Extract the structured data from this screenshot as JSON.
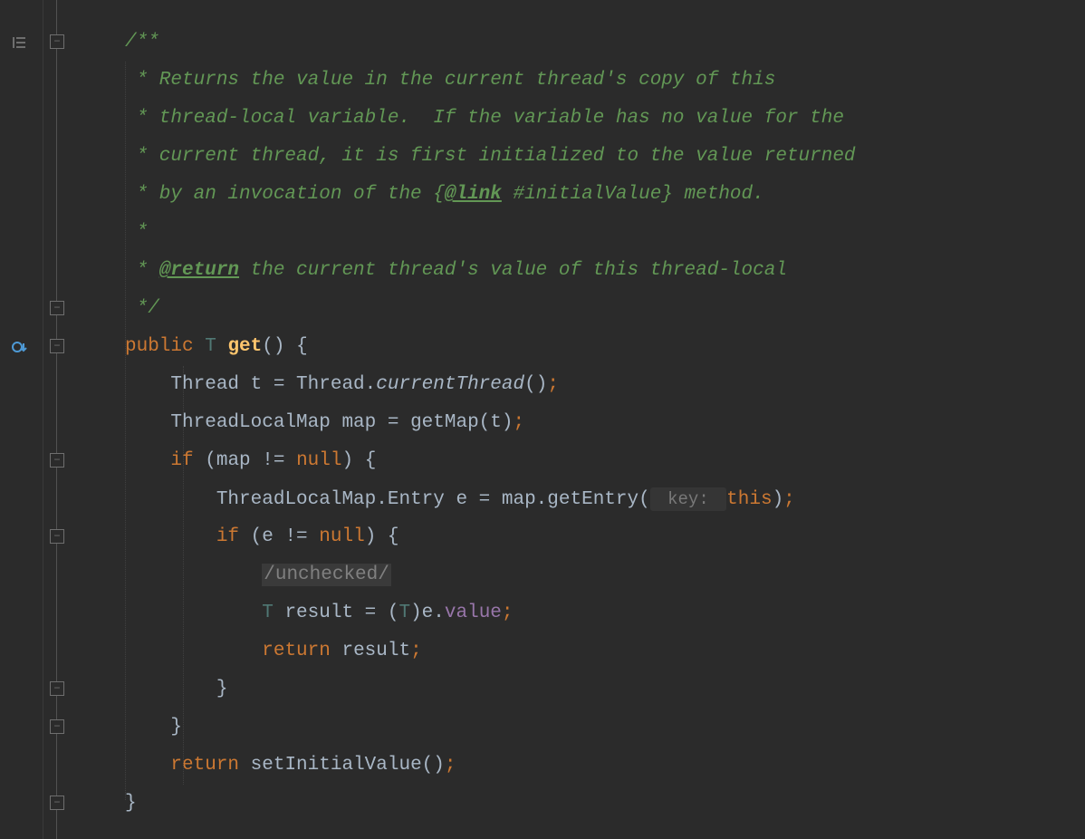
{
  "code": {
    "doc_open": "/**",
    "doc_l1_a": " * Returns the value in the current thread's copy of this",
    "doc_l2_a": " * thread-local variable.  If the variable has no value for the",
    "doc_l3_a": " * current thread, it is first initialized to the value returned",
    "doc_l4_a": " * by an invocation of the {",
    "doc_link": "@link",
    "doc_l4_b": " #initialValue} method.",
    "doc_blank": " *",
    "doc_ret_a": " * ",
    "doc_ret_tag": "@return",
    "doc_ret_b": " the current thread's value of this thread-local",
    "doc_close": " */",
    "sig_public": "public",
    "sig_T": "T",
    "sig_get": "get",
    "sig_parens": "() {",
    "l1_a": "Thread t = Thread.",
    "l1_b": "currentThread",
    "l1_c": "()",
    "l2_a": "ThreadLocalMap map = getMap(t)",
    "if1_a": "if",
    "if1_b": " (map != ",
    "null": "null",
    "if1_c": ") {",
    "l3_a": "ThreadLocalMap.Entry e = map.getEntry(",
    "hint_key": " key: ",
    "this": "this",
    "l3_c": ")",
    "if2_a": "if",
    "if2_b": " (e != ",
    "if2_c": ") {",
    "suppress": "/unchecked/",
    "l4_a": "T",
    "l4_b": " result = (",
    "l4_c": "T",
    "l4_d": ")e.",
    "l4_field": "value",
    "ret1_a": "return",
    "ret1_b": " result",
    "brace_close": "}",
    "ret2_a": "return",
    "ret2_b": " setInitialValue()",
    "semi": ";"
  }
}
